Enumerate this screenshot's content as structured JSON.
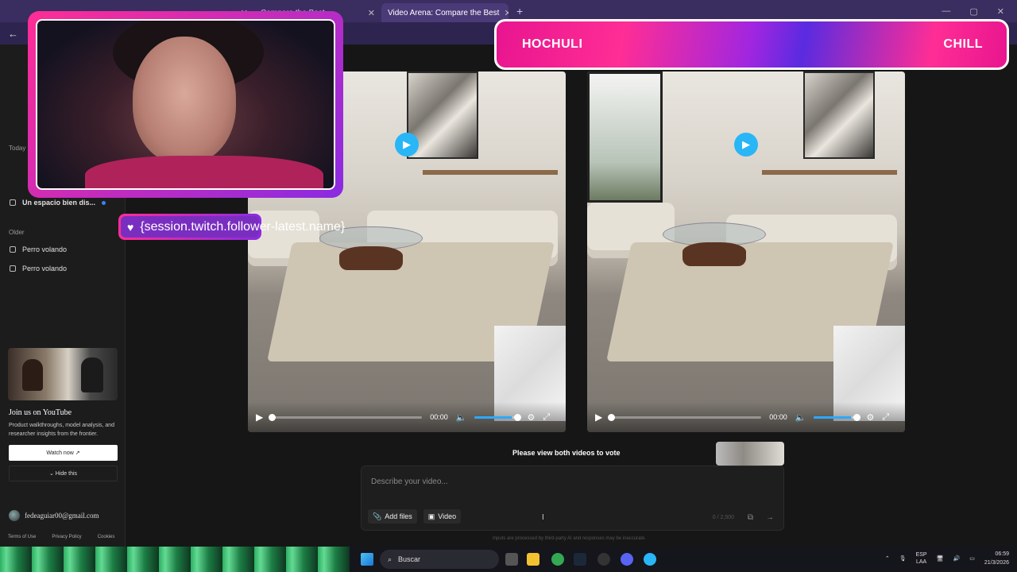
{
  "browser": {
    "tabs": [
      {
        "label": ""
      },
      {
        "label": ""
      },
      {
        "label": "Compare the Best"
      },
      {
        "label": "Video Arena: Compare the Best"
      }
    ],
    "new_tab": "+"
  },
  "sidebar": {
    "today_label": "Today",
    "today_items": [
      {
        "label": "Un espacio bien dis..."
      }
    ],
    "older_label": "Older",
    "older_items": [
      {
        "label": "Perro volando"
      },
      {
        "label": "Perro volando"
      }
    ],
    "youtube": {
      "title": "Join us on YouTube",
      "desc": "Product walkthroughs, model analysis, and researcher insights from the frontier.",
      "watch_label": "Watch now ↗",
      "hide_label": "⌄ Hide this"
    },
    "user_email": "fedeaguiar00@gmail.com",
    "footer": [
      "Terms of Use",
      "Privacy Policy",
      "Cookies"
    ]
  },
  "videos": [
    {
      "time": "00:00",
      "volume": 0.85
    },
    {
      "time": "00:00",
      "volume": 0.85
    }
  ],
  "vote_message": "Please view both videos to vote",
  "prompt": {
    "placeholder": "Describe your video...",
    "add_files": "Add files",
    "video": "Video",
    "counter": "0 / 2,500"
  },
  "disclaimer": "Inputs are processed by third-party AI and responses may be inaccurate.",
  "overlay": {
    "follower_text": "{session.twitch.follower-latest.name}",
    "banner_left": "HOCHULI",
    "banner_right": "CHILL"
  },
  "taskbar": {
    "search": "Buscar",
    "lang": "ESP",
    "lang2": "LAA",
    "time": "06:59",
    "date": "21/3/2026"
  },
  "colors": {
    "accent": "#29b6f6",
    "overlay_pink": "#ff2d95",
    "overlay_purple": "#8a2be2"
  }
}
